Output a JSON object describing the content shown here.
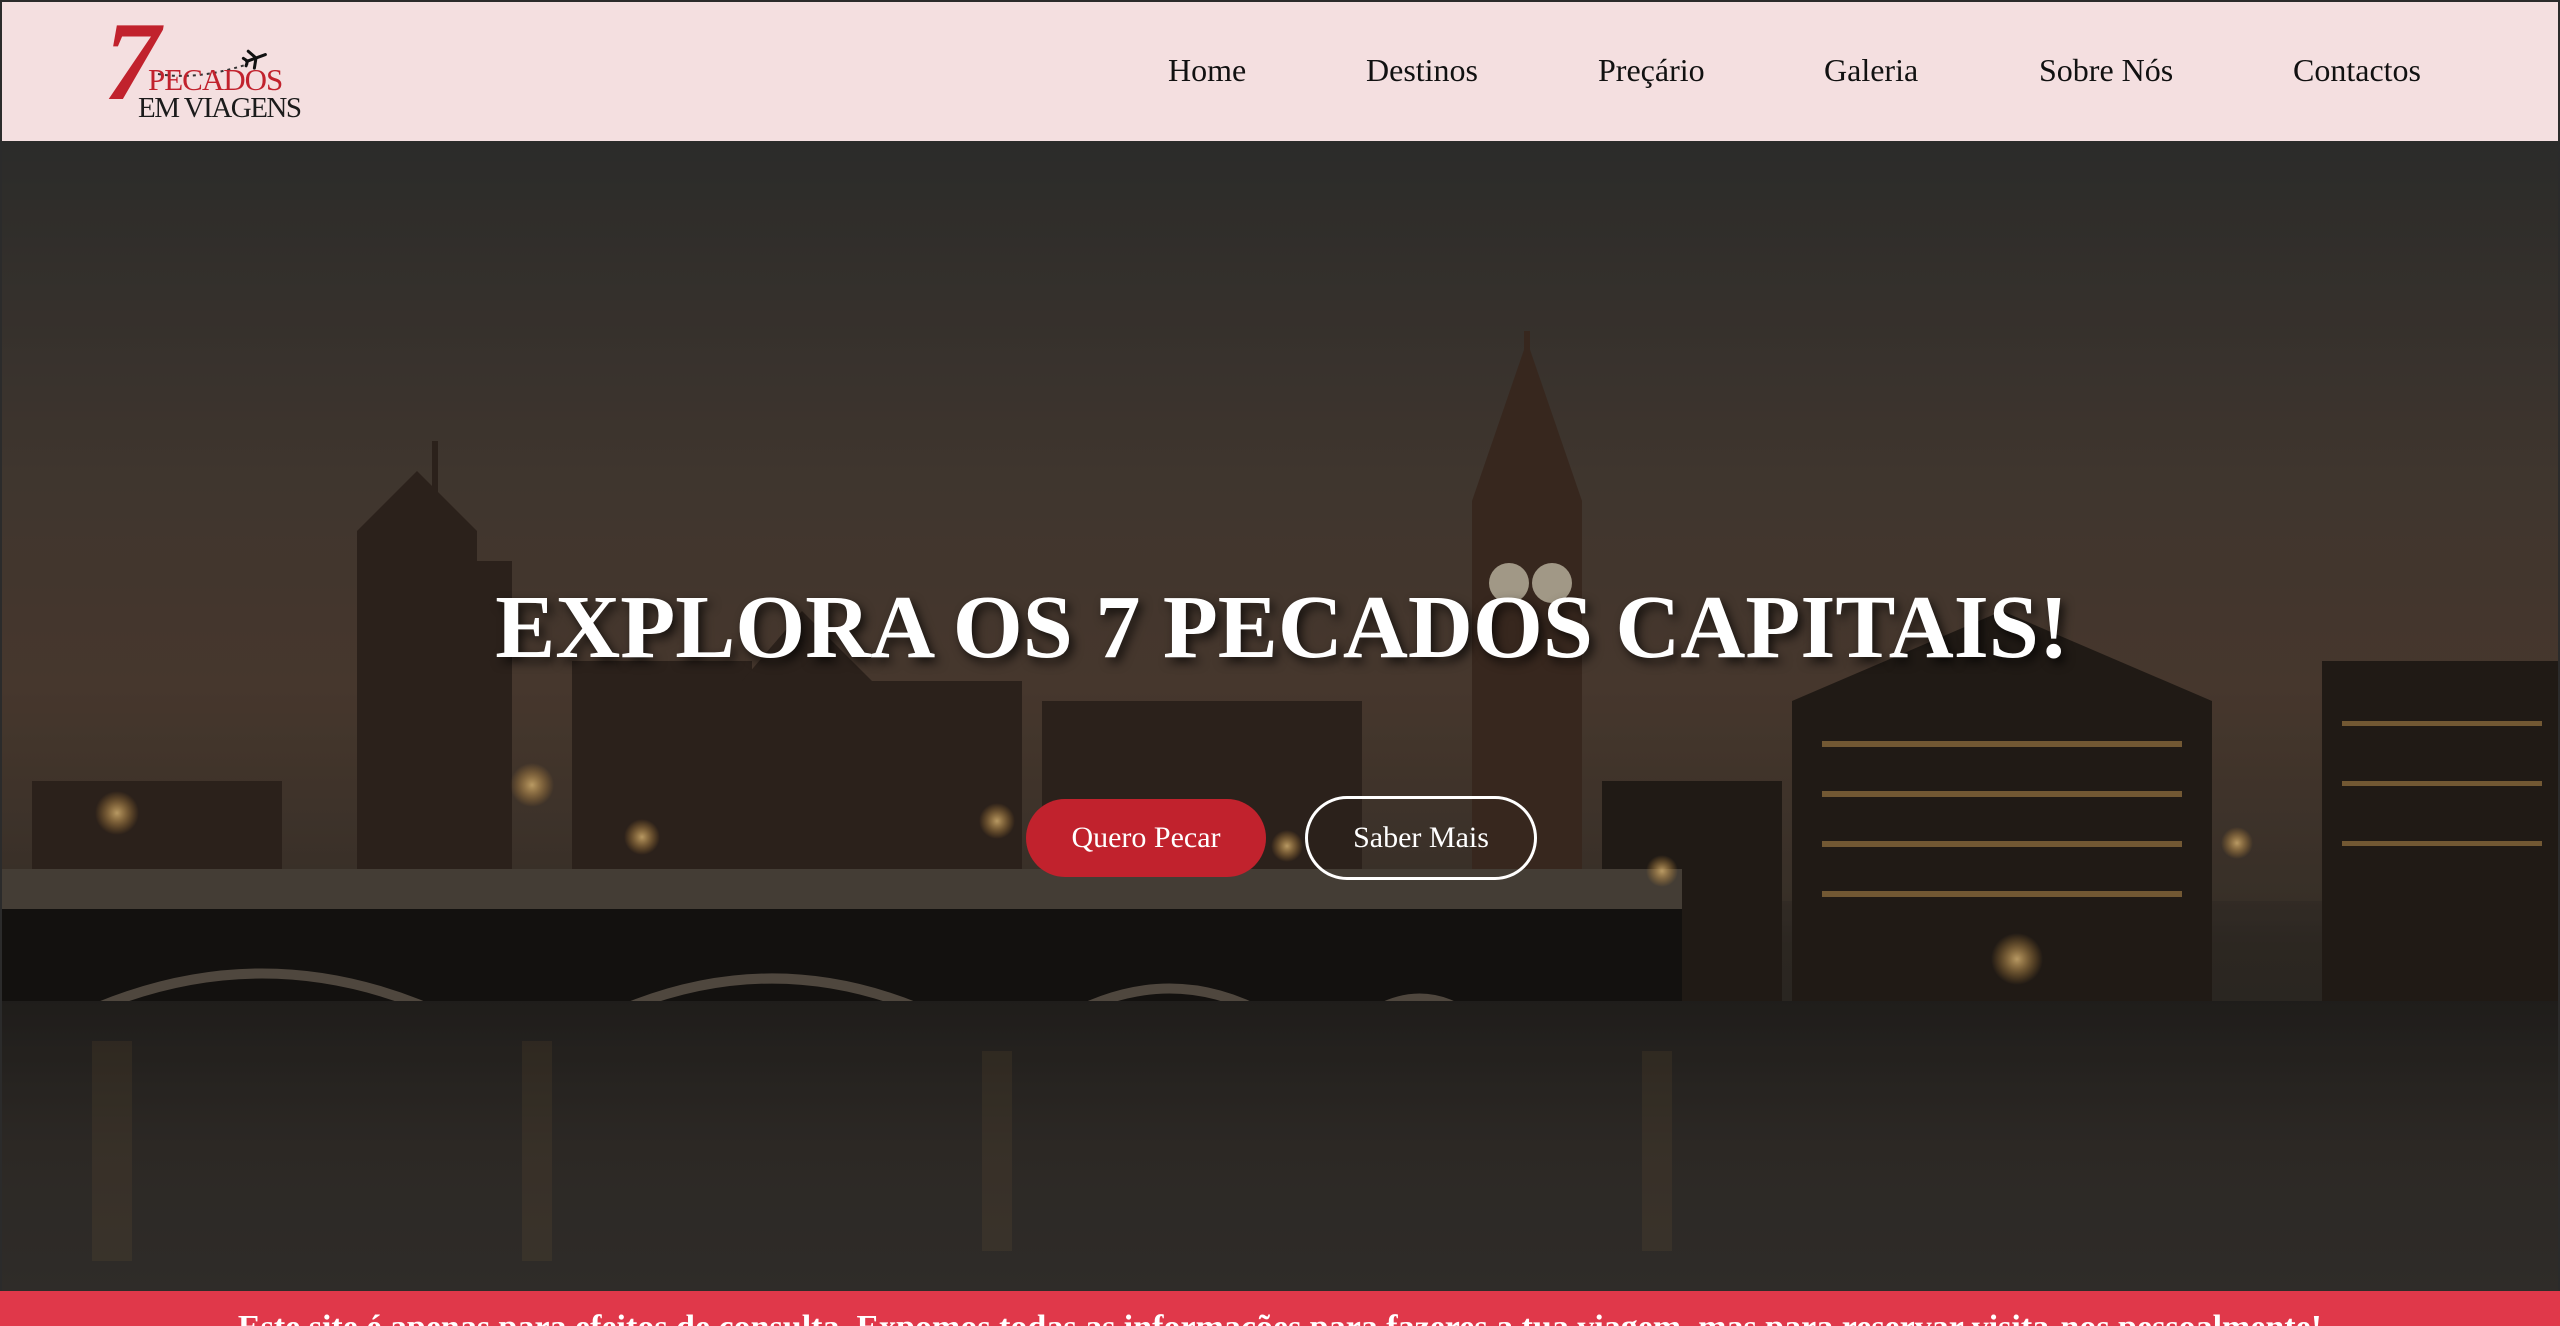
{
  "brand": {
    "logo_number": "7",
    "logo_line1": "PECADOS",
    "logo_line2": "EM VIAGENS",
    "color_primary": "#c1222d",
    "color_header_bg": "#f4dfe0",
    "plane_icon": "airplane-icon"
  },
  "nav": {
    "items": [
      {
        "label": "Home"
      },
      {
        "label": "Destinos"
      },
      {
        "label": "Preçário"
      },
      {
        "label": "Galeria"
      },
      {
        "label": "Sobre Nós"
      },
      {
        "label": "Contactos"
      }
    ]
  },
  "hero": {
    "title": "EXPLORA OS 7 PECADOS CAPITAIS!",
    "primary_button": "Quero Pecar",
    "secondary_button": "Saber Mais",
    "background_description_icon": "london-skyline-image"
  },
  "notice": {
    "text": "Este site é apenas para efeitos de consulta. Expomos todas as informações para fazeres a tua viagem, mas para reservar visita-nos pessoalmente!",
    "color": "#e0384a"
  }
}
